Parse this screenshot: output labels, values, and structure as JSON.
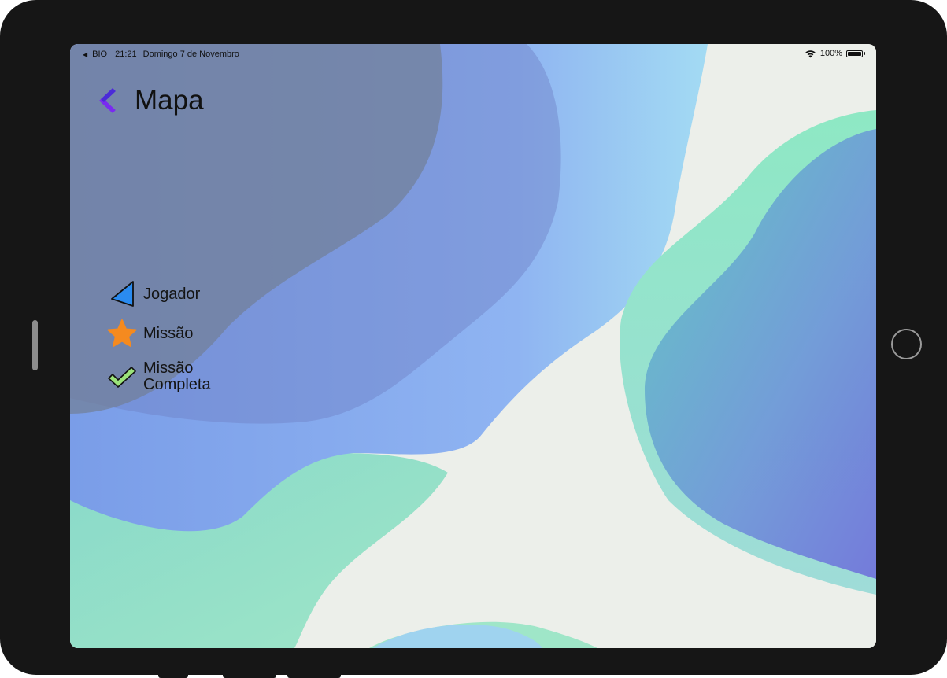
{
  "status_bar": {
    "carrier": "BIO",
    "time": "21:21",
    "date": "Domingo 7 de Novembro",
    "battery": "100%",
    "wifi_icon": "wifi-icon",
    "battery_icon": "battery-icon"
  },
  "header": {
    "title": "Mapa",
    "back_icon": "chevron-left-icon"
  },
  "legend": {
    "items": [
      {
        "icon": "player-arrow-icon",
        "label": "Jogador"
      },
      {
        "icon": "star-icon",
        "label": "Missão"
      },
      {
        "icon": "checkmark-icon",
        "label_line1": "Missão",
        "label_line2": "Completa"
      }
    ]
  },
  "colors": {
    "accent_purple": "#7a2bf0",
    "player_blue": "#2a8bf0",
    "mission_orange": "#f58a1f",
    "complete_green": "#9be37a",
    "screen_background": "#ecefea"
  }
}
